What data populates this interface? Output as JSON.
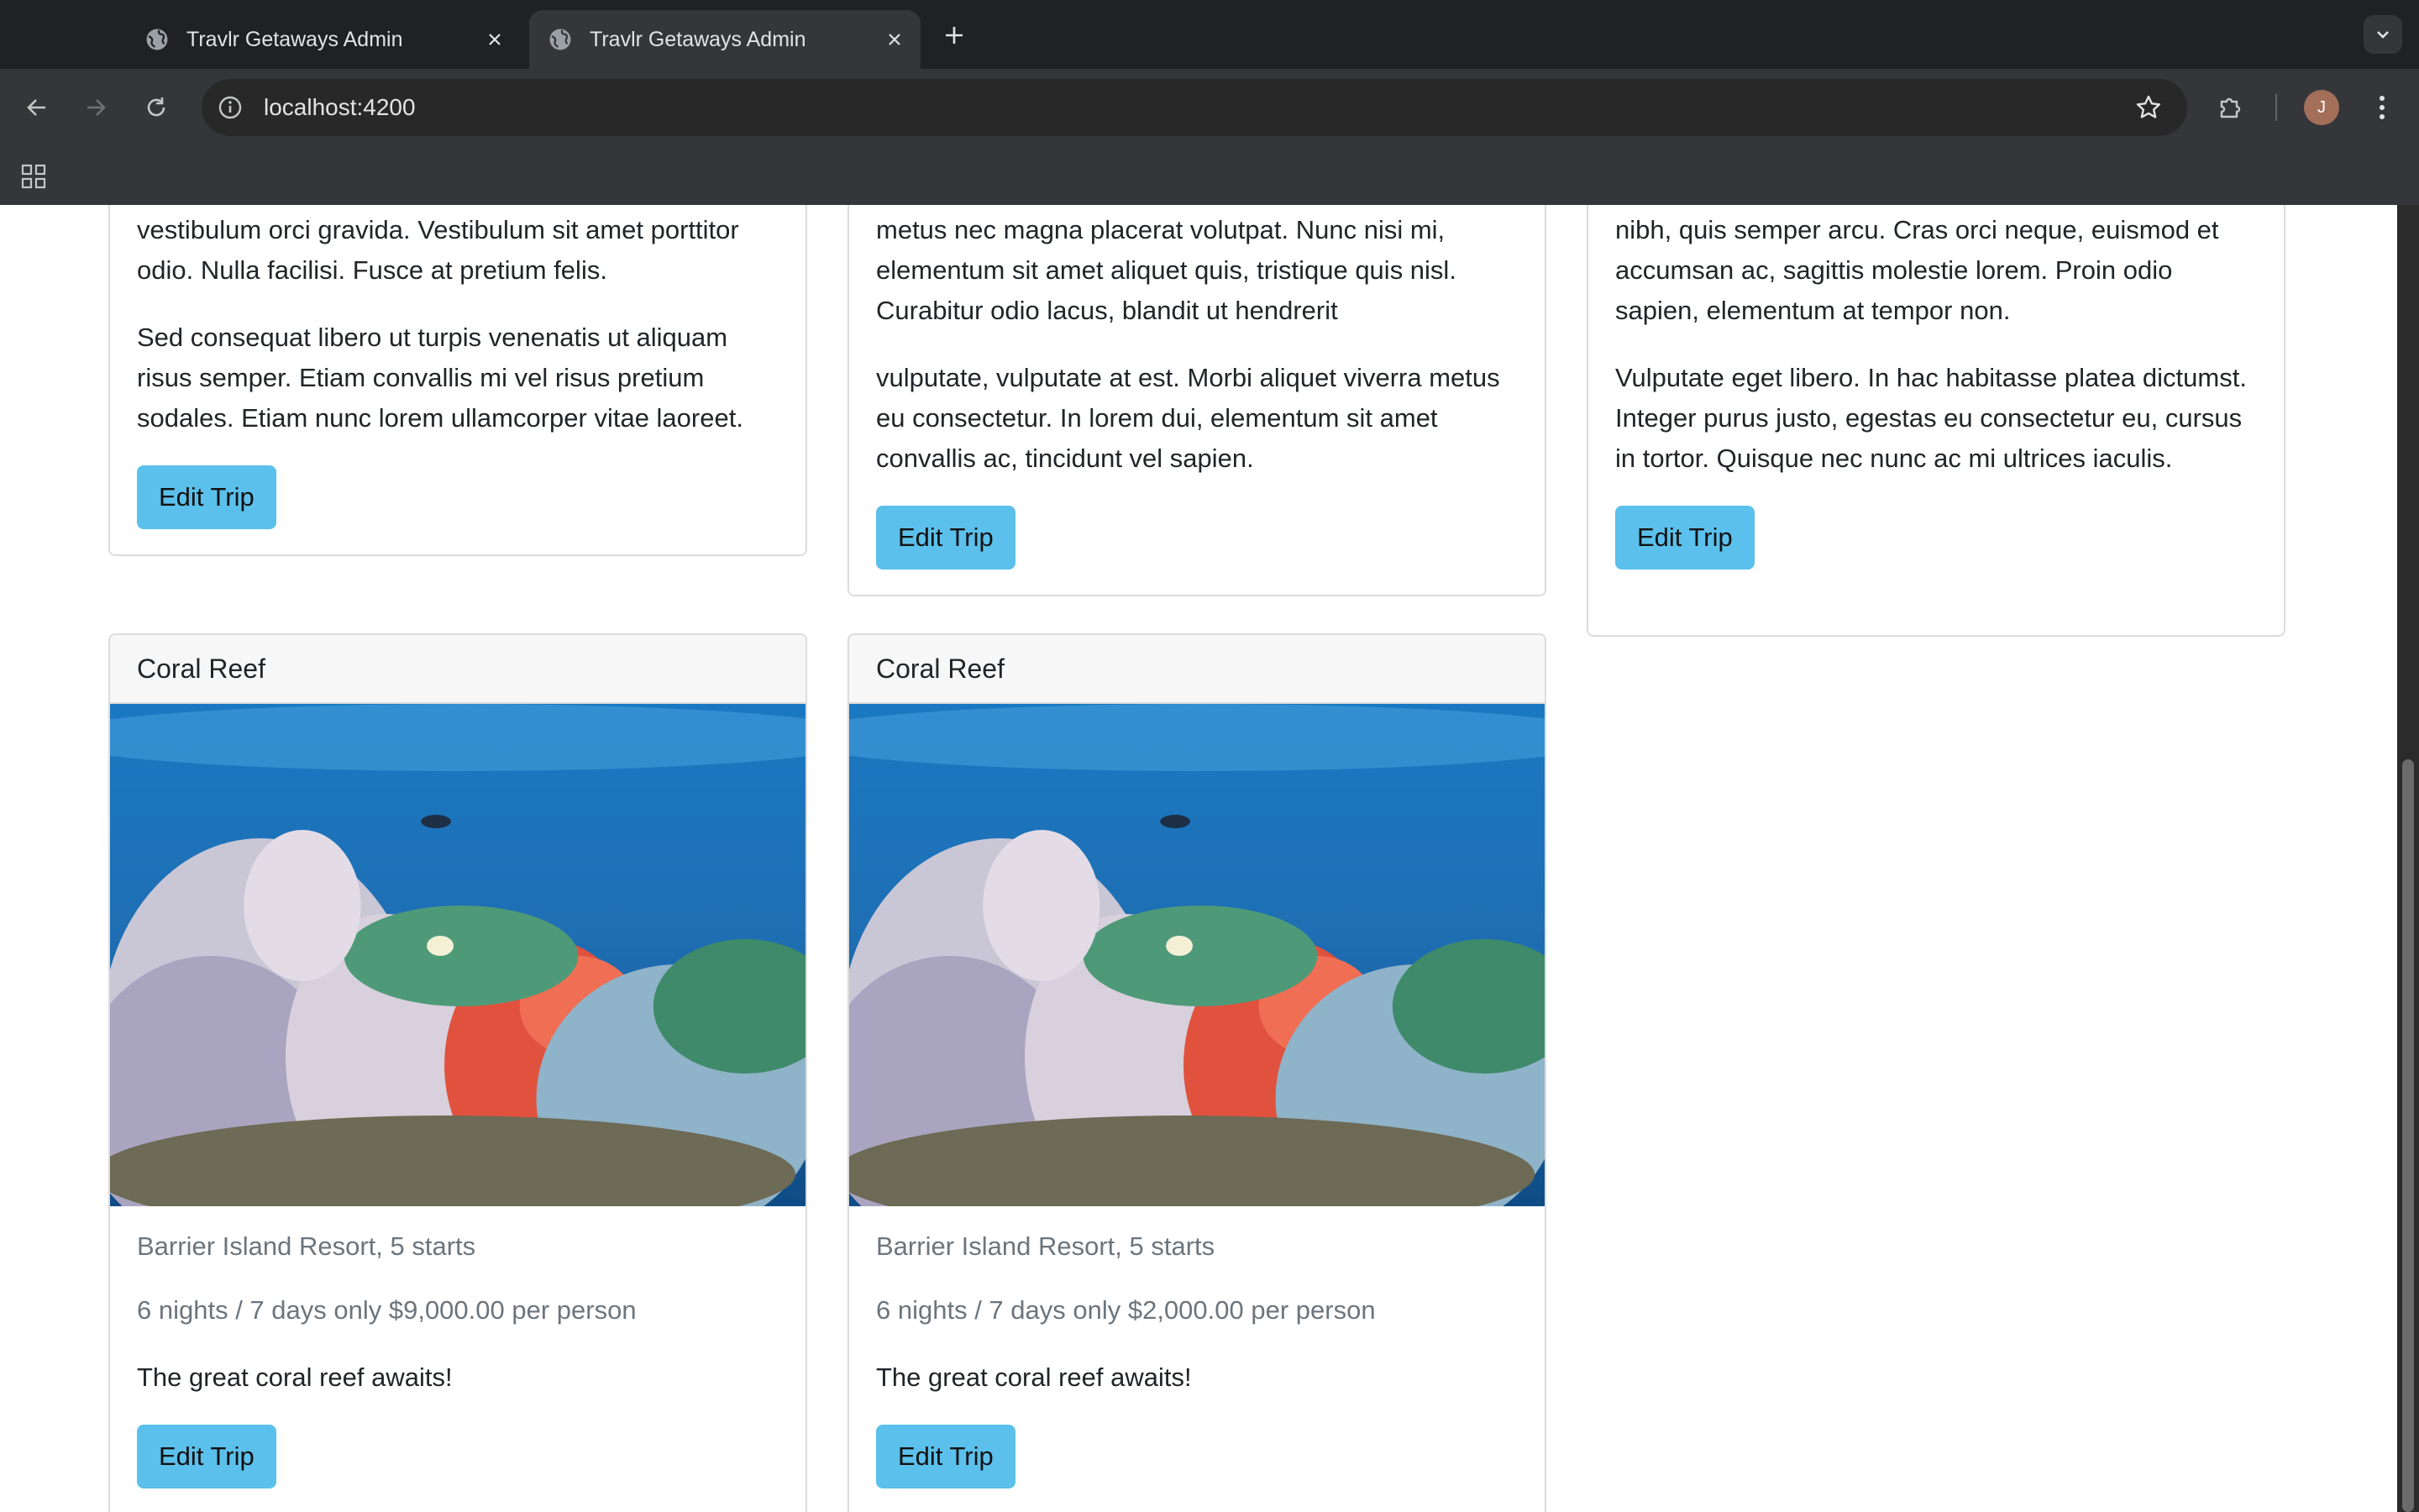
{
  "browser": {
    "tabs": [
      {
        "title": "Travlr Getaways Admin",
        "active": false
      },
      {
        "title": "Travlr Getaways Admin",
        "active": true
      }
    ],
    "url": "localhost:4200",
    "avatar_initial": "J"
  },
  "top_cards": [
    {
      "paragraphs": [
        "vestibulum orci gravida. Vestibulum sit amet porttitor odio. Nulla facilisi. Fusce at pretium felis.",
        "Sed consequat libero ut turpis venenatis ut aliquam risus semper. Etiam convallis mi vel risus pretium sodales. Etiam nunc lorem ullamcorper vitae laoreet."
      ],
      "button": "Edit Trip"
    },
    {
      "paragraphs": [
        "metus nec magna placerat volutpat. Nunc nisi mi, elementum sit amet aliquet quis, tristique quis nisl. Curabitur odio lacus, blandit ut hendrerit",
        "vulputate, vulputate at est. Morbi aliquet viverra metus eu consectetur. In lorem dui, elementum sit amet convallis ac, tincidunt vel sapien."
      ],
      "button": "Edit Trip"
    },
    {
      "paragraphs": [
        "nibh, quis semper arcu. Cras orci neque, euismod et accumsan ac, sagittis molestie lorem. Proin odio sapien, elementum at tempor non.",
        "Vulputate eget libero. In hac habitasse platea dictumst. Integer purus justo, egestas eu consectetur eu, cursus in tortor. Quisque nec nunc ac mi ultrices iaculis."
      ],
      "button": "Edit Trip"
    }
  ],
  "bottom_cards": [
    {
      "name": "Coral Reef",
      "resort": "Barrier Island Resort, 5 starts",
      "price_line": "6 nights / 7 days only $9,000.00 per person",
      "description": "The great coral reef awaits!",
      "button": "Edit Trip"
    },
    {
      "name": "Coral Reef",
      "resort": "Barrier Island Resort, 5 starts",
      "price_line": "6 nights / 7 days only $2,000.00 per person",
      "description": "The great coral reef awaits!",
      "button": "Edit Trip"
    }
  ],
  "colors": {
    "button": "#5bc0eb",
    "card_border": "#dcdcdc",
    "muted_text": "#6c757d"
  }
}
